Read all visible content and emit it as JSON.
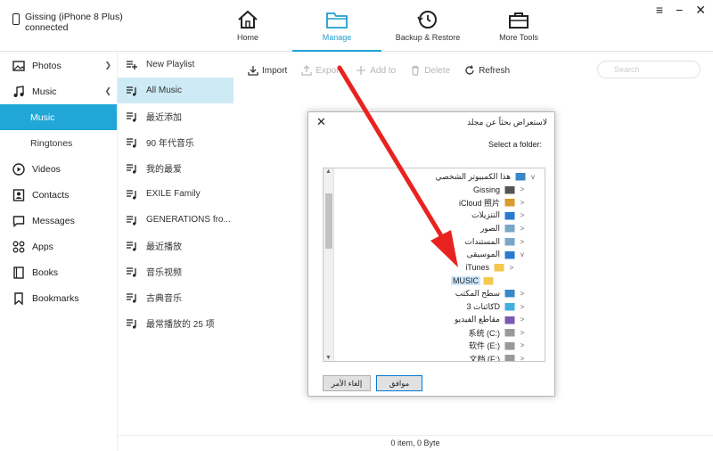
{
  "device": {
    "name": "Gissing (iPhone 8 Plus)",
    "status": "connected"
  },
  "nav": [
    {
      "label": "Home",
      "icon": "home-icon"
    },
    {
      "label": "Manage",
      "icon": "folder-icon"
    },
    {
      "label": "Backup & Restore",
      "icon": "backup-restore-icon"
    },
    {
      "label": "More Tools",
      "icon": "toolbox-icon"
    }
  ],
  "window_controls": {
    "menu": "≡",
    "minimize": "−",
    "close": "✕"
  },
  "sidebar": {
    "photos": "Photos",
    "music": "Music",
    "music_sub": [
      "Music",
      "Ringtones"
    ],
    "videos": "Videos",
    "contacts": "Contacts",
    "messages": "Messages",
    "apps": "Apps",
    "books": "Books",
    "bookmarks": "Bookmarks"
  },
  "playlists": {
    "new_label": "New Playlist",
    "items": [
      "All Music",
      "最近添加",
      "90 年代音乐",
      "我的最爱",
      "EXILE Family",
      "GENERATIONS fro...",
      "最近播放",
      "音乐视频",
      "古典音乐",
      "最常播放的 25 项"
    ]
  },
  "toolbar": {
    "import": "Import",
    "export": "Export",
    "add": "Add to",
    "delete": "Delete",
    "refresh": "Refresh",
    "search_placeholder": "Search"
  },
  "status": {
    "text": "0 item, 0 Byte"
  },
  "dialog": {
    "title": "لاستعراض بحثاً عن مجلد",
    "close": "✕",
    "prompt": "Select a folder:",
    "tree": [
      {
        "label": "هذا الكمبيوتر الشخصي",
        "chev": "v"
      },
      {
        "label": "Gissing",
        "chev": ">"
      },
      {
        "label": "iCloud 照片",
        "chev": ">"
      },
      {
        "label": "التنزيلات",
        "chev": ">"
      },
      {
        "label": "الصور",
        "chev": ">"
      },
      {
        "label": "المستندات",
        "chev": ">"
      },
      {
        "label": "الموسيقى",
        "chev": "v"
      },
      {
        "label": "iTunes",
        "chev": ">"
      },
      {
        "label": "MUSIC",
        "chev": ""
      },
      {
        "label": "سطح المكتب",
        "chev": ">"
      },
      {
        "label": "كائنات 3D",
        "chev": ">"
      },
      {
        "label": "مقاطع الفيديو",
        "chev": ">"
      },
      {
        "label": "系统 (C:)",
        "chev": ">"
      },
      {
        "label": "软件 (E:)",
        "chev": ">"
      },
      {
        "label": "文档 (F:)",
        "chev": ">"
      }
    ],
    "cancel": "إلغاء الأمر",
    "ok": "موافق"
  },
  "colors": {
    "accent": "#20a7d7",
    "arrow": "#e8231f",
    "selected_row": "#cdeaf5"
  }
}
